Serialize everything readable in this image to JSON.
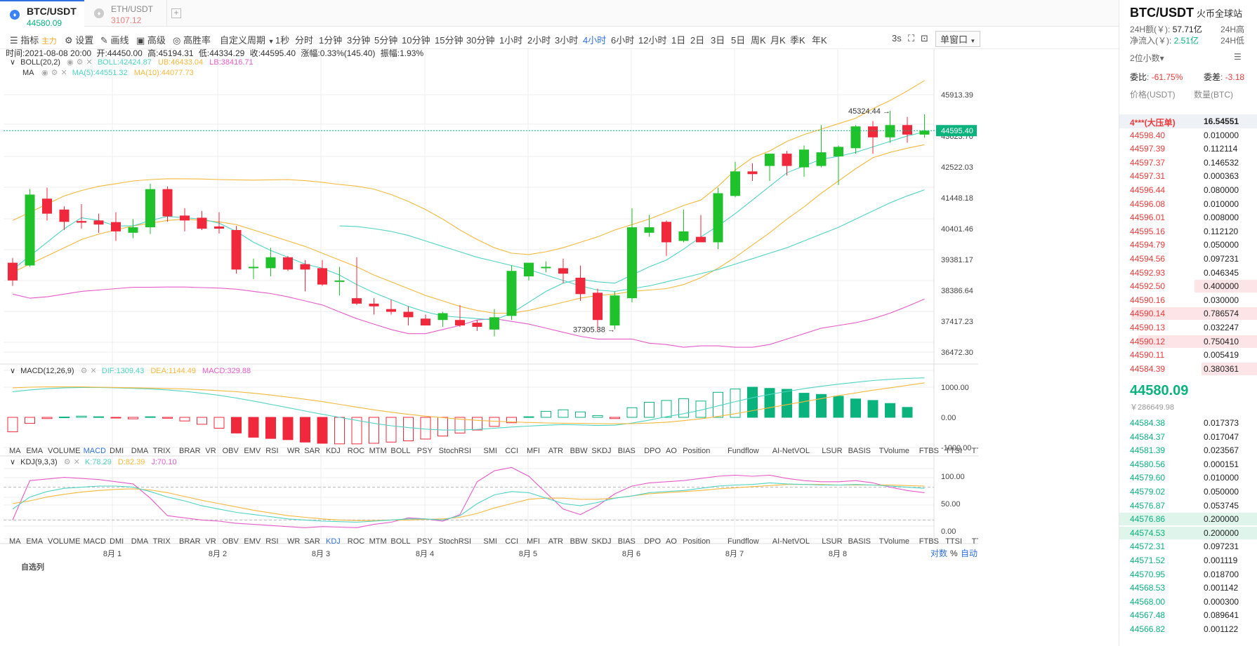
{
  "tabs": [
    {
      "symbol": "BTC/USDT",
      "price": "44580.09",
      "price_color": "#0ab37c"
    },
    {
      "symbol": "ETH/USDT",
      "price": "3107.12",
      "price_color": "#ec7e7e"
    }
  ],
  "toolbar": {
    "indicators": "指标",
    "indicators_sub": "主力",
    "settings": "设置",
    "draw": "画线",
    "advanced": "高级",
    "winrate": "高胜率",
    "custom_period": "自定义周期",
    "periods": [
      "1秒",
      "分时",
      "1分钟",
      "3分钟",
      "5分钟",
      "10分钟",
      "15分钟",
      "30分钟",
      "1小时",
      "2小时",
      "3小时",
      "4小时",
      "6小时",
      "12小时",
      "1日",
      "2日",
      "3日",
      "5日",
      "周K",
      "月K",
      "季K",
      "年K"
    ],
    "active_period": "4小时",
    "refresh": "3s",
    "window": "单窗口"
  },
  "info": {
    "time": "时间:2021-08-08 20:00",
    "open": "开:44450.00",
    "high": "高:45194.31",
    "low": "低:44334.29",
    "close": "收:44595.40",
    "change": "涨幅:0.33%(145.40)",
    "amplitude": "振幅:1.93%"
  },
  "boll": {
    "label": "BOLL(20,2)",
    "mid": "BOLL:42424.87",
    "ub": "UB:46433.04",
    "lb": "LB:38416.71"
  },
  "ma": {
    "label": "MA",
    "ma5": "MA(5):44551.32",
    "ma10": "MA(10):44077.73"
  },
  "macd": {
    "label": "MACD(12,26,9)",
    "dif": "DIF:1309.43",
    "dea": "DEA:1144.49",
    "macd": "MACD:329.88",
    "axis": [
      "1000.00",
      "0.00",
      "-1000.00"
    ]
  },
  "kdj": {
    "label": "KDJ(9,3,3)",
    "k": "K:78.29",
    "d": "D:82.39",
    "j": "J:70.10",
    "axis": [
      "100.00",
      "50.00",
      "0.00"
    ]
  },
  "indicator_bar": [
    "MA",
    "EMA",
    "VOLUME",
    "MACD",
    "DMI",
    "DMA",
    "TRIX",
    "BRAR",
    "VR",
    "OBV",
    "EMV",
    "RSI",
    "WR",
    "SAR",
    "KDJ",
    "ROC",
    "MTM",
    "BOLL",
    "PSY",
    "StochRSI",
    "SMI",
    "CCI",
    "MFI",
    "ATR",
    "BBW",
    "SKDJ",
    "BIAS",
    "DPO",
    "AO",
    "Position",
    "Fundflow",
    "AI-NetVOL",
    "LSUR",
    "BASIS",
    "TVolume",
    "FTBS",
    "TTSI",
    "TTMU",
    "AI-BSI"
  ],
  "main_axis": [
    "45913.39",
    "43623.70",
    "42522.03",
    "41448.18",
    "40401.46",
    "39381.17",
    "38386.64",
    "37417.23",
    "36472.30"
  ],
  "last_close_label": "44595.40",
  "annotations": {
    "high": "45324.44",
    "low": "37305.38"
  },
  "x_labels": [
    "8月 1",
    "8月 2",
    "8月 3",
    "8月 4",
    "8月 5",
    "8月 6",
    "8月 7",
    "8月 8"
  ],
  "bottom_right": {
    "log": "对数",
    "pct": "%",
    "auto": "自动"
  },
  "footer_cut": "自选列",
  "colors": {
    "up": "#1fc22a",
    "down": "#f0283c",
    "macd_up": "#0ab37c",
    "boll_band": "#f5b83d",
    "boll_mid": "#4fd3c4",
    "lb": "#e75bc9",
    "accent": "#2f6fe0"
  },
  "chart_data": {
    "type": "candlestick",
    "interval": "4小时",
    "candles": [
      [
        39750,
        39930,
        38900,
        39100
      ],
      [
        39650,
        42450,
        39600,
        42250
      ],
      [
        42100,
        42500,
        41300,
        41550
      ],
      [
        41700,
        41820,
        40950,
        41250
      ],
      [
        41280,
        41900,
        41000,
        41220
      ],
      [
        41300,
        41550,
        40850,
        41150
      ],
      [
        41240,
        41600,
        40550,
        40900
      ],
      [
        40850,
        41350,
        40650,
        41050
      ],
      [
        41050,
        42650,
        40800,
        42450
      ],
      [
        42450,
        42550,
        41250,
        41450
      ],
      [
        41480,
        41750,
        40900,
        41300
      ],
      [
        41400,
        41650,
        40950,
        41000
      ],
      [
        41080,
        41600,
        40820,
        41000
      ],
      [
        40950,
        41100,
        39350,
        39500
      ],
      [
        39550,
        39900,
        39150,
        39600
      ],
      [
        39550,
        40300,
        39250,
        39950
      ],
      [
        39950,
        40000,
        39450,
        39500
      ],
      [
        39700,
        39850,
        38700,
        39500
      ],
      [
        39550,
        39850,
        38900,
        38950
      ],
      [
        39050,
        39600,
        38550,
        39100
      ],
      [
        38450,
        39950,
        38200,
        38250
      ],
      [
        38250,
        38450,
        37850,
        38150
      ],
      [
        38050,
        38400,
        37850,
        37950
      ],
      [
        37950,
        38150,
        37450,
        37750
      ],
      [
        37700,
        37850,
        37500,
        37450
      ],
      [
        37650,
        37950,
        37400,
        37900
      ],
      [
        37650,
        38200,
        37400,
        37450
      ],
      [
        37550,
        37650,
        37250,
        37400
      ],
      [
        37300,
        38050,
        37050,
        37750
      ],
      [
        37800,
        39650,
        37650,
        39450
      ],
      [
        39250,
        39750,
        39100,
        39750
      ],
      [
        39600,
        39800,
        39400,
        39600
      ],
      [
        39550,
        39900,
        39000,
        39350
      ],
      [
        39200,
        39650,
        38350,
        38600
      ],
      [
        38650,
        38800,
        37250,
        37650
      ],
      [
        37450,
        38700,
        37305,
        38550
      ],
      [
        38450,
        41750,
        38300,
        41050
      ],
      [
        40850,
        41500,
        40700,
        41050
      ],
      [
        41250,
        41300,
        40000,
        40500
      ],
      [
        40550,
        41700,
        40500,
        40900
      ],
      [
        40700,
        41500,
        40600,
        40500
      ],
      [
        40500,
        42500,
        40250,
        42300
      ],
      [
        42200,
        43450,
        42150,
        43100
      ],
      [
        43100,
        43400,
        42750,
        43000
      ],
      [
        43300,
        43750,
        42750,
        43750
      ],
      [
        43750,
        43850,
        42950,
        43300
      ],
      [
        43250,
        44050,
        42900,
        43900
      ],
      [
        43300,
        44800,
        43250,
        43800
      ],
      [
        43650,
        44050,
        42600,
        44000
      ],
      [
        43950,
        44800,
        43750,
        44750
      ],
      [
        44750,
        44950,
        43750,
        44350
      ],
      [
        44350,
        45324,
        44150,
        44800
      ],
      [
        44800,
        45100,
        44150,
        44450
      ],
      [
        44450,
        45194,
        44334,
        44595
      ]
    ],
    "ma5": [
      39500,
      40000,
      40500,
      41000,
      41400,
      41300,
      41100,
      41100,
      41300,
      41450,
      41400,
      41350,
      41200,
      40900,
      40500,
      40200,
      39950,
      39700,
      39550,
      39300,
      38950,
      38650,
      38400,
      38150,
      37950,
      37800,
      37750,
      37700,
      37650,
      37900,
      38300,
      38700,
      39000,
      39150,
      39050,
      39000,
      39300,
      39600,
      39850,
      40250,
      40700,
      41100,
      41550,
      42050,
      42550,
      43050,
      43300,
      43550,
      43650,
      43800,
      44000,
      44200,
      44400,
      44551
    ],
    "ma10": [
      39400,
      39700,
      40000,
      40300,
      40600,
      40800,
      40950,
      41100,
      41200,
      41300,
      41350,
      41300,
      41250,
      41150,
      40950,
      40750,
      40550,
      40350,
      40100,
      39850,
      39600,
      39300,
      39050,
      38800,
      38550,
      38350,
      38150,
      38000,
      37900,
      37900,
      38000,
      38150,
      38300,
      38450,
      38550,
      38600,
      38700,
      38750,
      38800,
      38950,
      39200,
      39550,
      39950,
      40400,
      40850,
      41350,
      41800,
      42300,
      42750,
      43200,
      43600,
      43800,
      43950,
      44078
    ],
    "boll_mid": [
      null,
      null,
      null,
      null,
      null,
      null,
      null,
      null,
      null,
      null,
      null,
      null,
      null,
      null,
      null,
      null,
      null,
      null,
      null,
      41100,
      41080,
      41000,
      40900,
      40750,
      40550,
      40350,
      40150,
      39950,
      39800,
      39650,
      39500,
      39300,
      39100,
      38900,
      38750,
      38700,
      38800,
      38900,
      39050,
      39200,
      39350,
      39500,
      39700,
      39900,
      40100,
      40300,
      40550,
      40800,
      41050,
      41350,
      41650,
      41950,
      42200,
      42425
    ],
    "boll_ub": [
      41300,
      41600,
      41900,
      42200,
      42400,
      42550,
      42650,
      42750,
      42800,
      42830,
      42830,
      42820,
      42800,
      42790,
      42780,
      42790,
      42800,
      42760,
      42700,
      42620,
      42560,
      42450,
      42250,
      42000,
      41700,
      41350,
      40950,
      40600,
      40300,
      40100,
      40050,
      40150,
      40300,
      40500,
      40700,
      40950,
      41150,
      41350,
      41600,
      41850,
      42050,
      42550,
      43150,
      43600,
      43850,
      44200,
      44450,
      44650,
      44850,
      45050,
      45400,
      45700,
      46050,
      46433
    ],
    "boll_lb": [
      38600,
      38450,
      38500,
      38600,
      38700,
      38750,
      38800,
      38850,
      38850,
      38860,
      38860,
      38840,
      38820,
      38780,
      38700,
      38620,
      38500,
      38350,
      38200,
      37950,
      37700,
      37500,
      37300,
      37150,
      37150,
      37300,
      37450,
      37650,
      37700,
      37600,
      37500,
      37350,
      37200,
      37050,
      36950,
      36950,
      36950,
      36800,
      36750,
      36650,
      36700,
      36700,
      36650,
      36650,
      36750,
      36950,
      37150,
      37350,
      37450,
      37550,
      37700,
      37900,
      38150,
      38417
    ],
    "macd_hist": [
      -480,
      -200,
      -40,
      10,
      40,
      20,
      -20,
      -50,
      20,
      -30,
      -120,
      -230,
      -360,
      -520,
      -660,
      -700,
      -740,
      -820,
      -860,
      -880,
      -880,
      -860,
      -820,
      -780,
      -720,
      -620,
      -520,
      -420,
      -300,
      -180,
      20,
      200,
      250,
      180,
      60,
      -40,
      320,
      500,
      560,
      620,
      540,
      830,
      940,
      1000,
      960,
      930,
      800,
      760,
      700,
      610,
      560,
      460,
      330
    ],
    "macd_dif": [
      850,
      910,
      950,
      980,
      990,
      990,
      980,
      960,
      940,
      910,
      860,
      800,
      730,
      640,
      540,
      430,
      320,
      210,
      100,
      0,
      -100,
      -200,
      -280,
      -340,
      -390,
      -420,
      -420,
      -400,
      -360,
      -320,
      -290,
      -260,
      -240,
      -250,
      -270,
      -260,
      -190,
      -90,
      20,
      120,
      240,
      380,
      520,
      650,
      760,
      860,
      950,
      1030,
      1100,
      1160,
      1220,
      1260,
      1290,
      1310
    ],
    "macd_dea": [
      980,
      1000,
      1010,
      1010,
      1010,
      1000,
      990,
      980,
      970,
      955,
      940,
      915,
      885,
      850,
      800,
      740,
      670,
      600,
      520,
      430,
      340,
      250,
      170,
      100,
      40,
      -10,
      -60,
      -100,
      -130,
      -150,
      -170,
      -185,
      -195,
      -200,
      -210,
      -215,
      -210,
      -190,
      -160,
      -110,
      -50,
      30,
      120,
      220,
      320,
      420,
      520,
      620,
      720,
      810,
      900,
      980,
      1060,
      1144
    ],
    "kdj_k": [
      40,
      62,
      72,
      78,
      80,
      82,
      82,
      80,
      72,
      62,
      55,
      46,
      40,
      34,
      30,
      26,
      22,
      20,
      18,
      17,
      16,
      18,
      20,
      22,
      22,
      20,
      28,
      50,
      66,
      72,
      70,
      60,
      50,
      46,
      52,
      60,
      64,
      70,
      72,
      74,
      78,
      82,
      84,
      85,
      88,
      86,
      85,
      84,
      84,
      85,
      84,
      82,
      80,
      78
    ],
    "kdj_d": [
      50,
      55,
      62,
      67,
      71,
      74,
      76,
      77,
      75,
      70,
      63,
      56,
      50,
      44,
      38,
      33,
      28,
      25,
      22,
      20,
      19,
      19,
      20,
      20,
      21,
      22,
      25,
      32,
      42,
      50,
      58,
      60,
      60,
      58,
      58,
      60,
      64,
      68,
      70,
      72,
      74,
      77,
      79,
      81,
      83,
      85,
      85,
      85,
      84,
      84,
      84,
      84,
      83,
      82
    ],
    "kdj_j": [
      20,
      92,
      95,
      98,
      96,
      94,
      90,
      86,
      60,
      28,
      24,
      20,
      18,
      14,
      12,
      10,
      8,
      6,
      8,
      7,
      6,
      12,
      16,
      24,
      22,
      18,
      30,
      90,
      110,
      116,
      100,
      70,
      40,
      30,
      46,
      68,
      82,
      88,
      90,
      92,
      96,
      100,
      102,
      100,
      102,
      96,
      92,
      90,
      90,
      92,
      88,
      80,
      74,
      70
    ]
  }
}
